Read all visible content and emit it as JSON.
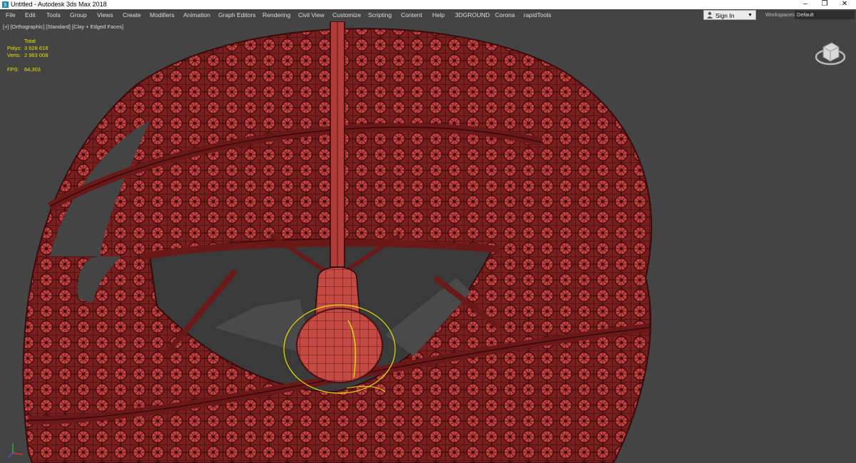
{
  "window": {
    "title": "Untitled - Autodesk 3ds Max 2018",
    "controls": {
      "minimize": "–",
      "restore": "❐",
      "close": "✕"
    }
  },
  "menu": {
    "items": [
      "File",
      "Edit",
      "Tools",
      "Group",
      "Views",
      "Create",
      "Modifiers",
      "Animation",
      "Graph Editors",
      "Rendering",
      "Civil View",
      "Customize",
      "Scripting",
      "Content",
      "Help",
      "3DGROUND",
      "Corona",
      "rapidTools"
    ]
  },
  "account": {
    "sign_in_label": "Sign In",
    "workspaces_label": "Workspaces:",
    "workspace_value": "Default"
  },
  "viewport": {
    "label_parts": [
      "[+]",
      "[Orthographic]",
      "[Standard]",
      "[Clay + Edged Faces]"
    ],
    "stats": {
      "header": "Total",
      "polys_label": "Polys:",
      "polys_value": "3 628 618",
      "verts_label": "Verts:",
      "verts_value": "2 963 008",
      "fps_label": "FPS:",
      "fps_value": "64,303"
    }
  },
  "colors": {
    "viewport_bg": "#444444",
    "mesh_fill": "#a83232",
    "mesh_edge": "#3a0a0a",
    "selection": "#e6e000",
    "stats_text": "#e8e000"
  },
  "icons": [
    "app-icon",
    "person-icon",
    "dropdown-caret-icon",
    "viewcube-icon",
    "axis-tripod-icon"
  ]
}
